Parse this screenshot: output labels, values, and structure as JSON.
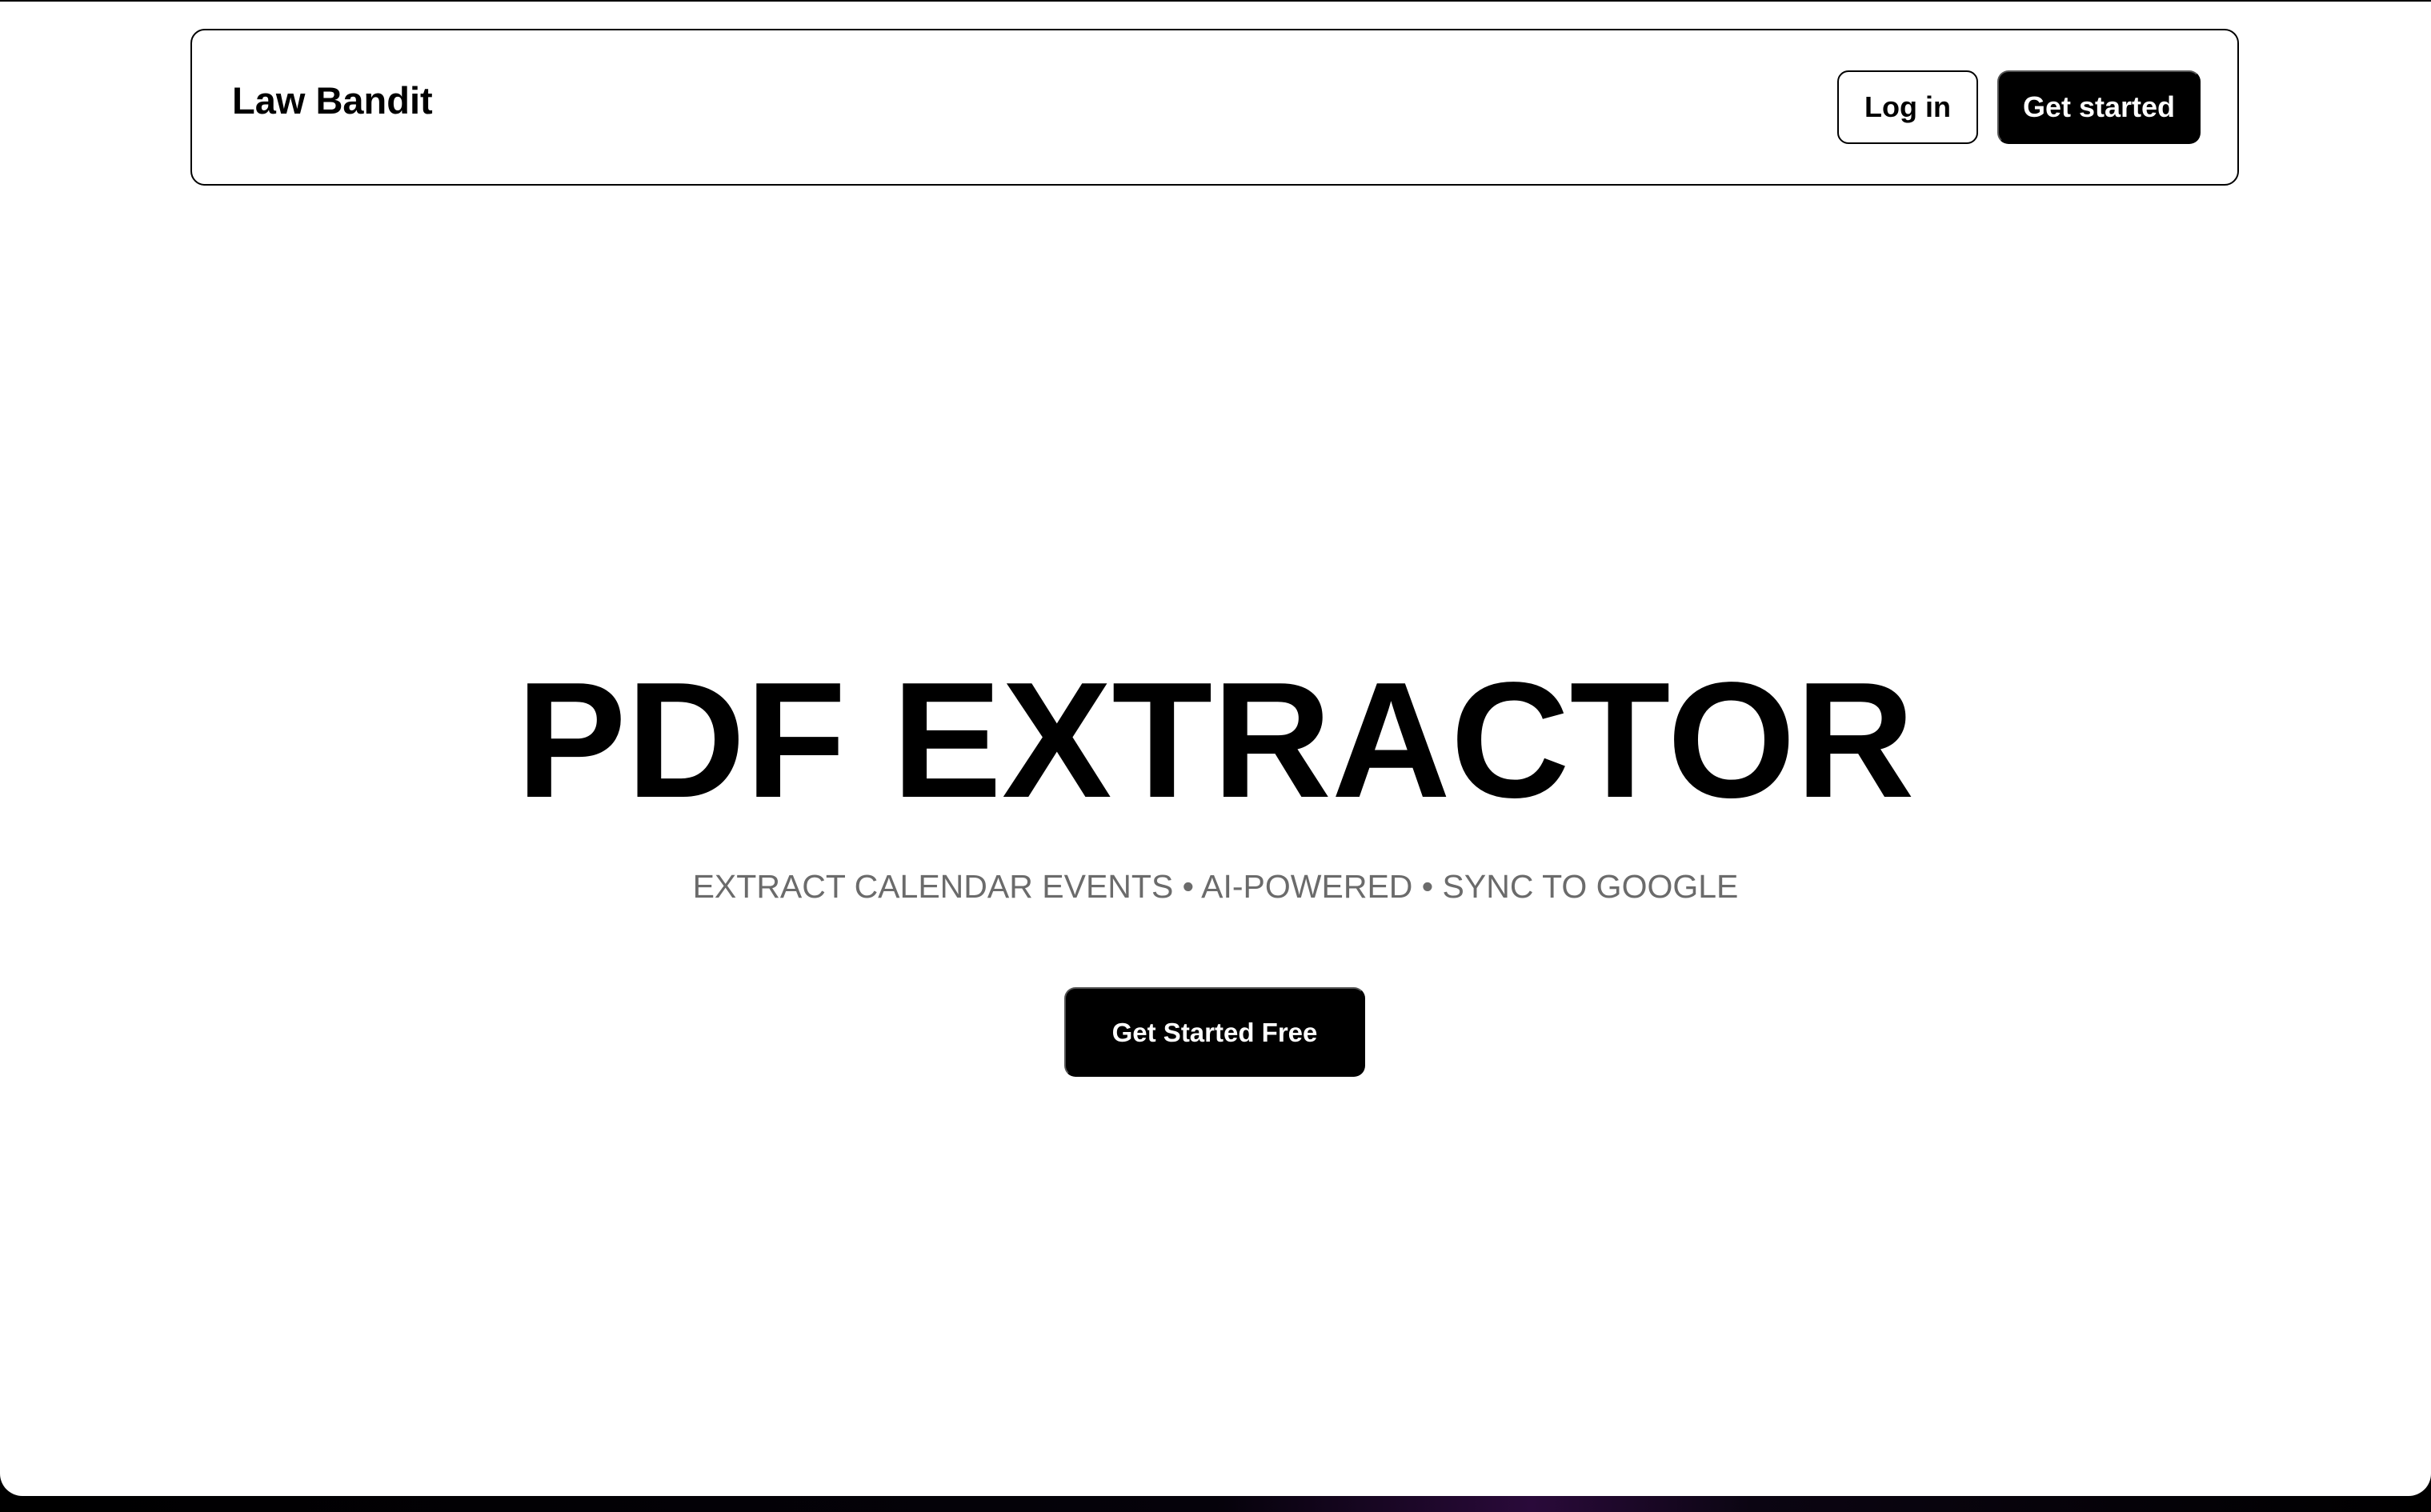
{
  "header": {
    "brand": "Law Bandit",
    "login_label": "Log in",
    "get_started_label": "Get started"
  },
  "hero": {
    "title": "PDF EXTRACTOR",
    "subtitle": "EXTRACT CALENDAR EVENTS • AI-POWERED • SYNC TO GOOGLE",
    "cta_label": "Get Started Free"
  },
  "colors": {
    "background": "#ffffff",
    "text": "#000000",
    "subtitle": "#6b6b6b",
    "button_primary": "#000000",
    "button_primary_text": "#ffffff"
  }
}
